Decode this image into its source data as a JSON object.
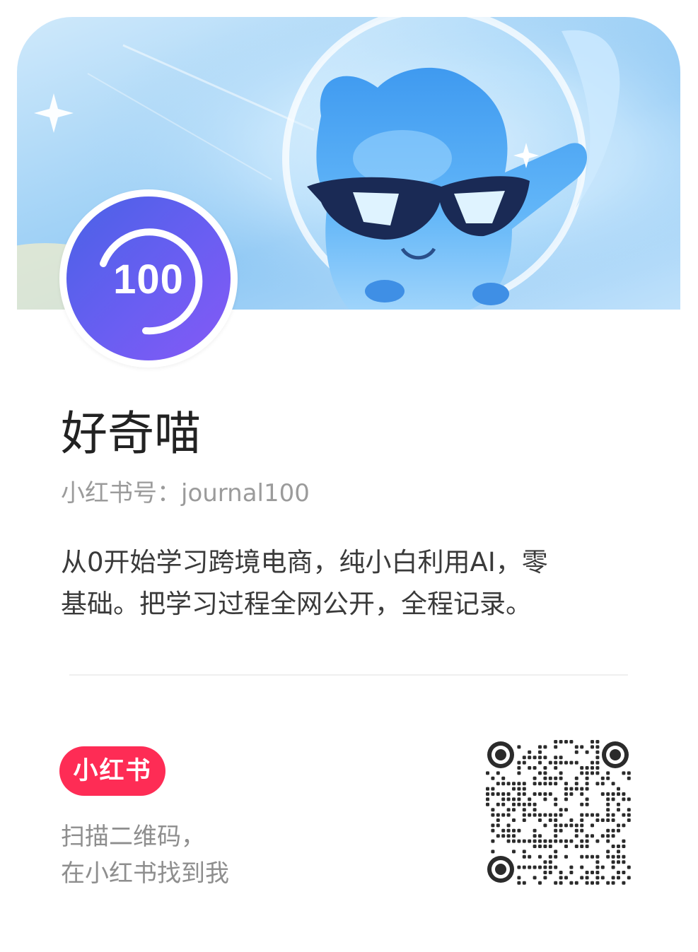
{
  "profile": {
    "name": "好奇喵",
    "account": "小红书号：journal100",
    "bio_lines": [
      "从0开始学习跨境电商，纯小白利用AI，零",
      "基础。把学习过程全网公开，全程记录。"
    ],
    "avatar_text": "100"
  },
  "footer": {
    "logo_text": "小红书",
    "scan_lines": [
      "扫描二维码，",
      "在小红书找到我"
    ]
  },
  "colors": {
    "brand_red": "#fe2c55",
    "avatar_start": "#4a62e6",
    "avatar_end": "#8559f5",
    "banner_blue": "#8fc8f4"
  },
  "icons": {
    "banner": "blue-mascot-with-sunglasses-illustration",
    "avatar": "100-progress-ring-logo",
    "qr": "qr-code"
  }
}
